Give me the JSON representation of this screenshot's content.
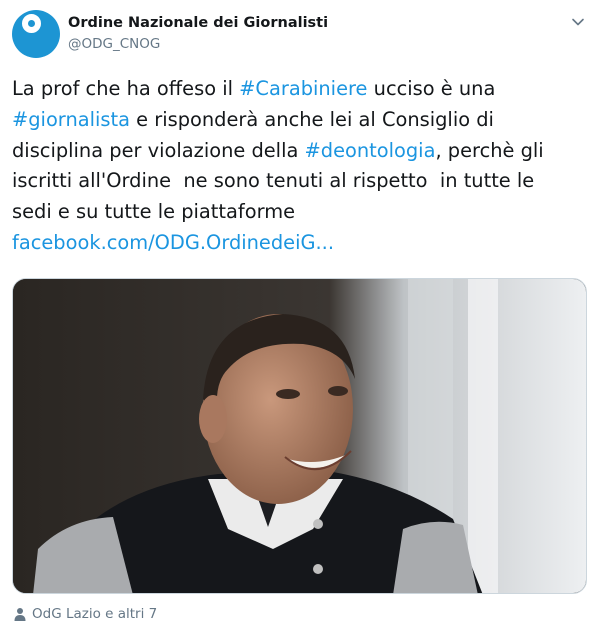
{
  "author": {
    "display_name": "Ordine Nazionale dei Giornalisti",
    "handle": "@ODG_CNOG",
    "avatar_icon": "odg-logo-icon",
    "brand_color": "#1d95d3"
  },
  "tweet": {
    "lines": [
      [
        {
          "t": "La prof che ha offeso il ",
          "k": "text"
        },
        {
          "t": "#Carabiniere",
          "k": "hashtag"
        },
        {
          "t": " ucciso è una",
          "k": "text"
        }
      ],
      [
        {
          "t": "#giornalista",
          "k": "hashtag"
        },
        {
          "t": " e risponderà anche lei al Consiglio di",
          "k": "text"
        }
      ],
      [
        {
          "t": "disciplina per violazione della ",
          "k": "text"
        },
        {
          "t": "#deontologia",
          "k": "hashtag"
        },
        {
          "t": ", perchè gli",
          "k": "text"
        }
      ],
      [
        {
          "t": "iscritti all'Ordine  ne sono tenuti al rispetto  in tutte le",
          "k": "text"
        }
      ],
      [
        {
          "t": "sedi e su tutte le piattaforme",
          "k": "text"
        }
      ],
      [
        {
          "t": "facebook.com/ODG.OrdinedeiG...",
          "k": "link"
        }
      ]
    ],
    "link_color": "#1b95e0"
  },
  "media": {
    "kind": "photo"
  },
  "social_context": {
    "text": "OdG Lazio e altri 7",
    "icon": "person-icon"
  },
  "menu": {
    "icon": "chevron-down-icon"
  }
}
